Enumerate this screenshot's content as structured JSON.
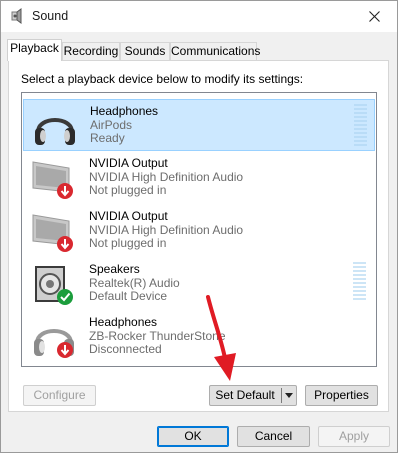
{
  "window": {
    "title": "Sound"
  },
  "tabs": [
    {
      "label": "Playback",
      "active": true
    },
    {
      "label": "Recording",
      "active": false
    },
    {
      "label": "Sounds",
      "active": false
    },
    {
      "label": "Communications",
      "active": false
    }
  ],
  "instruction": "Select a playback device below to modify its settings:",
  "devices": [
    {
      "name": "Headphones",
      "sub": "AirPods",
      "status": "Ready",
      "icon": "headphones-icon",
      "selected": true
    },
    {
      "name": "NVIDIA Output",
      "sub": "NVIDIA High Definition Audio",
      "status": "Not plugged in",
      "icon": "monitor-icon",
      "selected": false
    },
    {
      "name": "NVIDIA Output",
      "sub": "NVIDIA High Definition Audio",
      "status": "Not plugged in",
      "icon": "monitor-icon",
      "selected": false
    },
    {
      "name": "Speakers",
      "sub": "Realtek(R) Audio",
      "status": "Default Device",
      "icon": "speaker-icon",
      "selected": false
    },
    {
      "name": "Headphones",
      "sub": "ZB-Rocker ThunderStone",
      "status": "Disconnected",
      "icon": "headphones-icon",
      "selected": false
    }
  ],
  "buttons": {
    "configure": "Configure",
    "set_default": "Set Default",
    "properties": "Properties",
    "ok": "OK",
    "cancel": "Cancel",
    "apply": "Apply"
  },
  "colors": {
    "selection_bg": "#cce8ff",
    "accent": "#0078d7",
    "annotation_arrow": "#e01b24"
  }
}
